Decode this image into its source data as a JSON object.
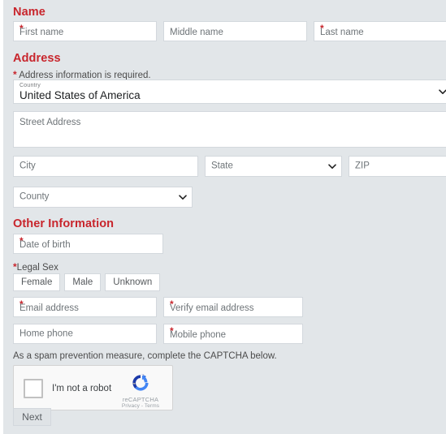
{
  "sections": {
    "name": {
      "heading": "Name",
      "fields": [
        {
          "placeholder": "First name",
          "required": true
        },
        {
          "placeholder": "Middle name",
          "required": false
        },
        {
          "placeholder": "Last name",
          "required": true
        }
      ]
    },
    "address": {
      "heading": "Address",
      "required_note": "Address information is required.",
      "country": {
        "label": "Country",
        "value": "United States of America"
      },
      "street": {
        "placeholder": "Street Address",
        "required": false
      },
      "city": {
        "placeholder": "City",
        "required": false
      },
      "state": {
        "placeholder": "State"
      },
      "zip": {
        "placeholder": "ZIP",
        "required": false
      },
      "county": {
        "placeholder": "County"
      }
    },
    "other": {
      "heading": "Other Information",
      "dob": {
        "placeholder": "Date of birth",
        "required": true
      },
      "legal_sex": {
        "label": "Legal Sex",
        "required": true,
        "options": [
          "Female",
          "Male",
          "Unknown"
        ]
      },
      "email": {
        "placeholder": "Email address",
        "required": true
      },
      "verify_email": {
        "placeholder": "Verify email address",
        "required": true
      },
      "home_phone": {
        "placeholder": "Home phone",
        "required": false
      },
      "mobile_phone": {
        "placeholder": "Mobile phone",
        "required": true
      }
    },
    "captcha": {
      "note": "As a spam prevention measure, complete the CAPTCHA below.",
      "checkbox_label": "I'm not a robot",
      "brand": "reCAPTCHA",
      "links": "Privacy - Terms"
    },
    "submit": {
      "label": "Next"
    }
  },
  "colors": {
    "background": "#e2e6e9",
    "heading": "#c8252c",
    "required_star": "#c8252c",
    "field_background": "#ffffff",
    "field_border": "#d3d8dd",
    "placeholder_text": "#6e7478",
    "button_background": "#dfe3e6"
  }
}
